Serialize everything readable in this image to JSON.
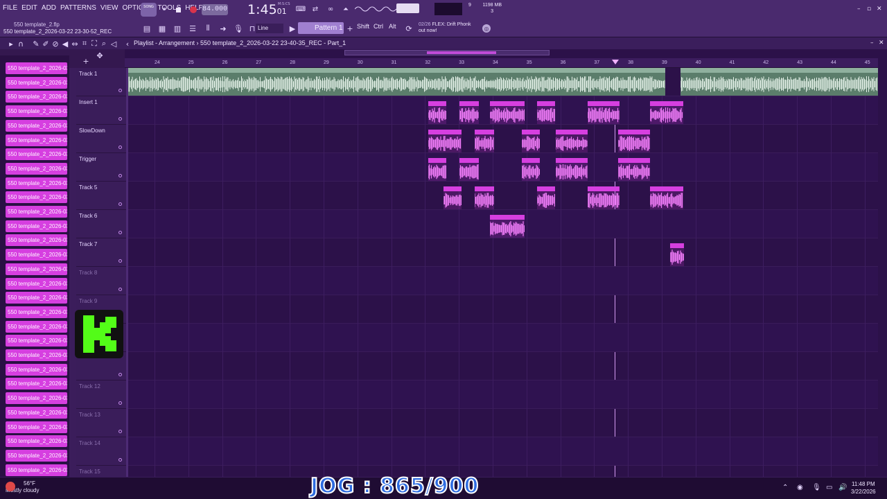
{
  "menu": [
    "FILE",
    "EDIT",
    "ADD",
    "PATTERNS",
    "VIEW",
    "OPTIONS",
    "TOOLS",
    "HELP"
  ],
  "project": {
    "file": "550 template_2.flp",
    "recording": "550 template_2_2026-03-22 23-30-52_REC"
  },
  "transport": {
    "song_label": "SONG",
    "tempo": "84.000",
    "time_main": "1:45",
    "time_ms": "01",
    "time_unit": "M:S:CS"
  },
  "perf": {
    "cpu": "9",
    "memory": "1198 MB",
    "polyphony": "3"
  },
  "toolbar": {
    "snap": "Line",
    "pattern": "Pattern 1",
    "shift": "Shift",
    "ctrl": "Ctrl",
    "alt": "Alt"
  },
  "news": {
    "count": "02/26",
    "text": "FLEX: Drift Phonk",
    "text2": "out now!"
  },
  "playlist": {
    "title": "Playlist - Arrangement",
    "breadcrumb": "550 template_2_2026-03-22 23-40-35_REC - Part_1"
  },
  "ruler": [
    "24",
    "25",
    "26",
    "27",
    "28",
    "29",
    "30",
    "31",
    "32",
    "33",
    "34",
    "35",
    "36",
    "37",
    "38",
    "39",
    "40",
    "41",
    "42",
    "43",
    "44",
    "45"
  ],
  "picker": {
    "item_label": "550 template_2_2026-03..."
  },
  "tracks": [
    {
      "name": "Track 1",
      "dim": false
    },
    {
      "name": "Insert 1",
      "dim": false
    },
    {
      "name": "SlowDown",
      "dim": false
    },
    {
      "name": "Trigger",
      "dim": false
    },
    {
      "name": "Track 5",
      "dim": false
    },
    {
      "name": "Track 6",
      "dim": false
    },
    {
      "name": "Track 7",
      "dim": false
    },
    {
      "name": "Track 8",
      "dim": true
    },
    {
      "name": "Track 9",
      "dim": true
    },
    {
      "name": "",
      "dim": true
    },
    {
      "name": "",
      "dim": true
    },
    {
      "name": "Track 12",
      "dim": true
    },
    {
      "name": "Track 13",
      "dim": true
    },
    {
      "name": "Track 14",
      "dim": true
    },
    {
      "name": "Track 15",
      "dim": true
    }
  ],
  "audio_clip_label": "Chris Wackem x JaeB - Sha Boing Boing",
  "clips": {
    "lane2": [
      "55..C",
      "55..C",
      "550 te..._REC",
      "55..C",
      "550 t..._REC",
      "550 te..._REC"
    ],
    "lane3": [
      "55..C",
      "55..C",
      "55..C",
      "550 t..._REC",
      "550 t..._REC"
    ],
    "lane4": [
      "55..C",
      "55..C",
      "55..C",
      "550 t..._REC",
      "550 t..._REC"
    ],
    "lane5": [
      "55..C",
      "55..EC",
      "55..C",
      "550 t..._REC",
      "55..EC"
    ],
    "lane6": [
      "550 te..._REC"
    ],
    "lane7": [
      ""
    ]
  },
  "taskbar": {
    "temp": "56°F",
    "weather": "Mostly cloudy",
    "jog": "JOG : 865/900",
    "time": "11:48 PM",
    "date": "3/22/2026"
  },
  "colors": {
    "accent": "#d63fe0",
    "background": "#2c1149",
    "audio_clip": "#5b7d6b"
  }
}
